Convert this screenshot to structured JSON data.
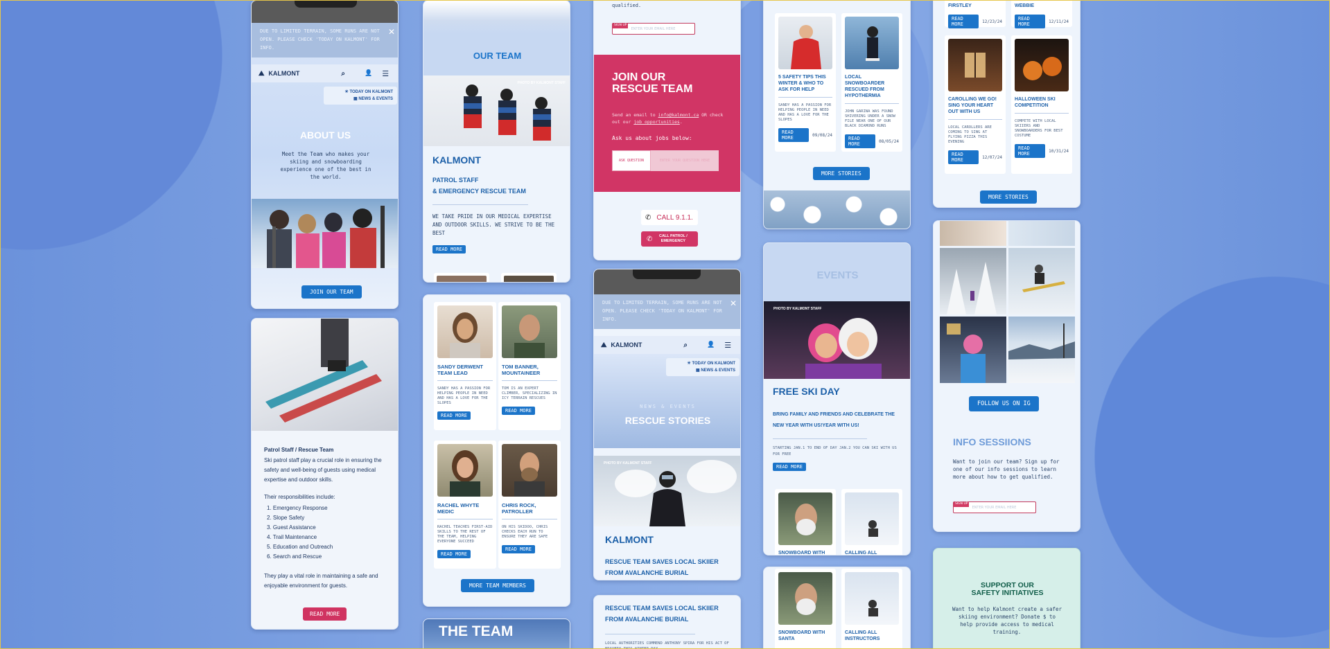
{
  "notice": {
    "text": "DUE TO LIMITED TERRAIN, SOME RUNS ARE NOT OPEN. PLEASE CHECK 'TODAY ON KALMONT' FOR INFO."
  },
  "brand": {
    "name": "KALMONT"
  },
  "menu": {
    "today": "TODAY ON KALMONT",
    "news": "NEWS & EVENTS"
  },
  "about": {
    "title": "ABOUT US",
    "text": "Meet the Team who makes your skiing and snowboarding experience one of the best in the world.",
    "button": "JOIN OUR TEAM"
  },
  "patrol": {
    "heading": "Patrol Staff / Rescue Team",
    "intro": "Ski patrol staff play a crucial role in ensuring the safety and well-being of guests using medical expertise and outdoor skills.",
    "resp_heading": "Their responsibilities include:",
    "items": [
      "1. Emergency Response",
      "2. Slope Safety",
      "3. Guest Assistance",
      "4. Trail Maintenance",
      "5. Education and Outreach",
      "6. Search and Rescue"
    ],
    "outro": "They play a vital role in maintaining a safe and enjoyable environment for guests.",
    "button": "READ MORE"
  },
  "ourteam": {
    "title": "OUR TEAM",
    "photo_credit": "PHOTO BY KALMONT STAFF",
    "brand": "KALMONT",
    "sub1": "PATROL STAFF",
    "sub2": "& EMERGENCY RESCUE TEAM",
    "text": "WE TAKE PRIDE IN OUR MEDICAL EXPERTISE AND OUTDOOR SKILLS. WE STRIVE TO BE THE BEST",
    "button": "READ MORE"
  },
  "members": [
    {
      "name": "SANDY DERWENT TEAM LEAD",
      "desc": "SANDY HAS A PASSION FOR HELPING PEOPLE IN NEED AND HAS A LOVE FOR THE SLOPES",
      "button": "READ MORE"
    },
    {
      "name": "TOM BANNER, MOUNTAINEER",
      "desc": "TOM IS AN EXPERT CLIMBER, SPECIALIZING IN ICY TERRAIN RESCUES",
      "button": "READ MORE"
    },
    {
      "name": "RACHEL WHYTE MEDIC",
      "desc": "RACHEL TEACHES FIRST-AID SKILLS TO THE REST OF THE TEAM, HELPING EVERYONE SUCCEED",
      "button": "READ MORE"
    },
    {
      "name": "CHRIS ROCK, PATROLLER",
      "desc": "ON HIS SKIDOO, CHRIS CHECKS EACH RUN TO ENSURE THEY ARE SAFE",
      "button": "READ MORE"
    }
  ],
  "more_members": "MORE TEAM MEMBERS",
  "theteam": {
    "title": "THE TEAM"
  },
  "join": {
    "qualified": "qualified.",
    "signup_tag": "SIGN UP",
    "email_placeholder": "ENTER YOUR EMAIL HERE",
    "title1": "JOIN OUR",
    "title2": "RESCUE TEAM",
    "send_pre": "Send an email to ",
    "email": "info@kalmont.ca",
    "send_mid": " OR check out our ",
    "link": "job opportunities",
    "send_post": ".",
    "ask": "Ask us about jobs below:",
    "ask_btn": "ASK QUESTION",
    "ask_placeholder": "ENTER YOUR QUESTION HERE",
    "call": "CALL 9.1.1.",
    "call_patrol": "CALL PATROL / EMERGENCY"
  },
  "rescue": {
    "kicker": "NEWS & EVENTS",
    "title": "RESCUE STORIES",
    "photo_credit": "PHOTO BY KALMONT STAFF",
    "brand": "KALMONT",
    "headline": "RESCUE TEAM SAVES LOCAL SKIIER FROM AVALANCHE BURIAL",
    "headline2": "RESCUE TEAM SAVES LOCAL SKIIER FROM AVALANCHE BURIAL",
    "text2": "LOCAL AUTHORITIES COMMEND ANTHONY SPIRA FOR HIS ACT OF BRAVERY THIS WINTER DAY"
  },
  "stories": [
    {
      "title": "5 SAFETY TIPS THIS WINTER & WHO TO ASK FOR HELP",
      "desc": "SANDY HAS A PASSION FOR HELPING PEOPLE IN NEED AND HAS A LOVE FOR THE SLOPES",
      "button": "READ MORE",
      "date": "09/08/24"
    },
    {
      "title": "LOCAL SNOWBOARDER RESCUED FROM HYPOTHERMIA",
      "desc": "JOHN GARINA WAS FOUND SHIVERING UNDER A SNOW FILE NEAR ONE OF OUR BLACK DIAMOND RUNS",
      "button": "READ MORE",
      "date": "08/05/24"
    }
  ],
  "more_stories": "MORE STORIES",
  "events": {
    "title": "EVENTS",
    "photo_credit": "PHOTO BY KALMONT STAFF",
    "headline": "FREE SKI DAY",
    "sub": "BRING FAMILY AND FRIENDS AND CELEBRATE THE NEW YEAR WITH US!YEAR WITH US!",
    "text": "STARTING JAN.1 TO END OF DAY JAN.2 YOU CAN SKI WITH US FOR FREE",
    "button": "READ MORE",
    "cards": [
      "SNOWBOARD WITH",
      "CALLING ALL"
    ],
    "cards2": [
      "SNOWBOARD WITH SANTA",
      "CALLING ALL INSTRUCTORS"
    ]
  },
  "top_right": {
    "btn1": "READ MORE",
    "date1": "12/23/24",
    "btn2": "READ MORE",
    "date2": "12/11/24",
    "frag1": "FIRSTLEY",
    "frag2": "WEBBIE"
  },
  "events_cards": [
    {
      "title": "CAROLLING WE GO! SING YOUR HEART OUT WITH US",
      "desc": "LOCAL CAROLLERS ARE COMING TO SING AT FLYING PIZZA THIS EVENING",
      "button": "READ MORE",
      "date": "12/07/24"
    },
    {
      "title": "HALLOWEEN SKI COMPETITION",
      "desc": "COMPETE WITH LOCAL SKIIERS AND SNOWBOARDERS FOR BEST COSTUME",
      "button": "READ MORE",
      "date": "10/31/24"
    }
  ],
  "instagram": {
    "button": "FOLLOW US ON IG"
  },
  "info": {
    "title": "INFO SESSIIONS",
    "text": "Want to join our team? Sign up for one of our info sessions to learn more about how to get qualified.",
    "signup_tag": "SIGN UP",
    "placeholder": "ENTER YOUR EMAIL HERE"
  },
  "support": {
    "title1": "SUPPORT OUR",
    "title2": "SAFETY INITIATIVES",
    "text": "Want to help Kalmont create a safer skiing environment? Donate $ to help provide access to medical training."
  }
}
